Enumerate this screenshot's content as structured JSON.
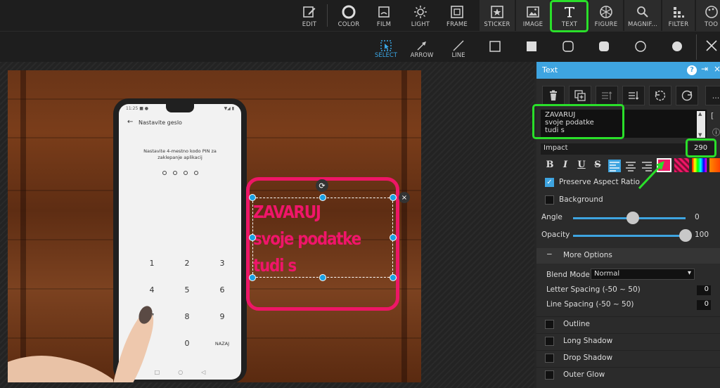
{
  "toolbar": {
    "tools": [
      {
        "label": "EDIT",
        "icon": "edit-icon"
      },
      {
        "label": "COLOR",
        "icon": "color-icon"
      },
      {
        "label": "FILM",
        "icon": "film-icon"
      },
      {
        "label": "LIGHT",
        "icon": "light-icon"
      },
      {
        "label": "FRAME",
        "icon": "frame-icon"
      },
      {
        "label": "STICKER",
        "icon": "sticker-icon"
      },
      {
        "label": "IMAGE",
        "icon": "image-icon"
      },
      {
        "label": "TEXT",
        "icon": "text-icon"
      },
      {
        "label": "FIGURE",
        "icon": "figure-icon"
      },
      {
        "label": "MAGNIF...",
        "icon": "magnifier-icon"
      },
      {
        "label": "FILTER",
        "icon": "filter-icon"
      },
      {
        "label": "TOO",
        "icon": "tools-icon"
      }
    ],
    "active": "TEXT"
  },
  "subbar": {
    "tools": [
      {
        "label": "SELECT",
        "icon": "select-icon"
      },
      {
        "label": "ARROW",
        "icon": "arrow-icon"
      },
      {
        "label": "LINE",
        "icon": "line-icon"
      }
    ],
    "shapes": [
      "square-outline-icon",
      "square-filled-icon",
      "rounded-square-outline-icon",
      "rounded-square-filled-icon",
      "circle-outline-icon",
      "circle-filled-icon"
    ],
    "close_icon": "close-icon"
  },
  "photo": {
    "phone": {
      "status_left": "11:25 ■ ●",
      "status_right": "▼◢ ▮",
      "back": "←",
      "title": "Nastavite geslo",
      "instruction": "Nastavite 4-mestno kodo PIN za zaklepanje aplikacij",
      "keys": [
        "1",
        "2",
        "3",
        "4",
        "5",
        "6",
        "7",
        "8",
        "9",
        "0",
        "NAZAJ"
      ],
      "nav": [
        "□",
        "○",
        "◁"
      ]
    },
    "overlay_text": "ZAVARUJ\nsvoje podatke\ntudi s",
    "rotate_glyph": "⟳",
    "close_glyph": "×"
  },
  "panel": {
    "title": "Text",
    "help_icon": "?",
    "pin_icon": "⇥",
    "close_icon": "×",
    "buttons": [
      "trash-icon",
      "duplicate-icon",
      "bring-forward-icon",
      "send-backward-icon",
      "rotate-left-icon",
      "rotate-right-icon",
      "more-icon"
    ],
    "more_label": "...",
    "text_value": "ZAVARUJ\nsvoje podatke\ntudi s",
    "scroll_up": "▲",
    "scroll_down": "▼",
    "extra_right_1": "[",
    "extra_right_2": "ⓘ",
    "font": "Impact",
    "font_size": "290",
    "format": {
      "bold": "B",
      "italic": "I",
      "underline": "U",
      "strike": "S"
    },
    "align_icons": [
      "align-left-icon",
      "align-center-icon",
      "align-right-icon"
    ],
    "text_color": "#ee1666",
    "preserve_aspect": {
      "label": "Preserve Aspect Ratio",
      "checked": true,
      "check_glyph": "✓"
    },
    "background": {
      "label": "Background",
      "checked": false
    },
    "angle": {
      "label": "Angle",
      "value": "0",
      "fraction": 0.53
    },
    "opacity": {
      "label": "Opacity",
      "value": "100",
      "fraction": 1.0
    },
    "more_options": {
      "toggle": "−",
      "label": "More Options"
    },
    "blend": {
      "label": "Blend Mode",
      "value": "Normal",
      "arrow": "▾"
    },
    "letter_spacing": {
      "label": "Letter Spacing (-50 ~ 50)",
      "value": "0"
    },
    "line_spacing": {
      "label": "Line Spacing (-50 ~ 50)",
      "value": "0"
    },
    "options": [
      "Outline",
      "Long Shadow",
      "Drop Shadow",
      "Outer Glow"
    ]
  },
  "colors": {
    "accent": "#3ea4e0",
    "highlight": "#2adf2a",
    "pink": "#ee1666"
  }
}
